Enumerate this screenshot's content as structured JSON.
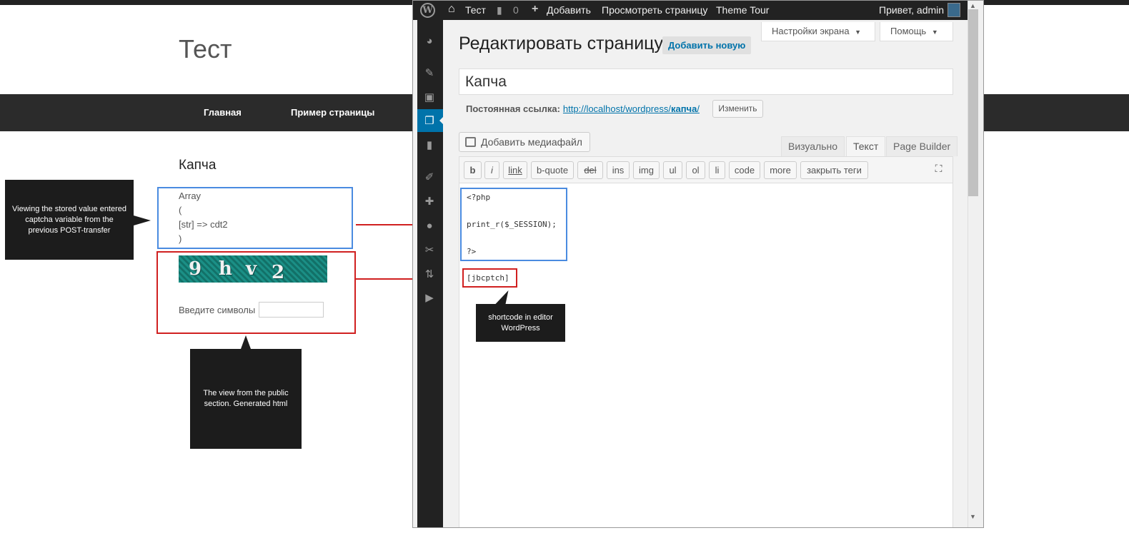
{
  "site": {
    "title": "Тест",
    "nav": [
      "Главная",
      "Пример страницы"
    ],
    "page_title": "Капча",
    "array_lines": [
      "Array",
      "(",
      "[str] => cdt2",
      ")"
    ],
    "captcha_chars": [
      "9",
      "h",
      "v",
      "2"
    ],
    "captcha_label": "Введите символы",
    "captcha_value": ""
  },
  "annotations": {
    "session_note": "Viewing the stored value entered captcha variable from the previous POST-transfer",
    "public_note": "The view from the public section. Generated html",
    "shortcode_note": "shortcode in editor WordPress"
  },
  "adminbar": {
    "site_name": "Тест",
    "comments_count": "0",
    "add_new": "Добавить",
    "view_page": "Просмотреть страницу",
    "theme_tour": "Theme Tour",
    "greeting": "Привет, admin"
  },
  "editor": {
    "screen_options": "Настройки экрана",
    "help": "Помощь",
    "heading": "Редактировать страницу",
    "add_new": "Добавить новую",
    "post_title": "Капча",
    "permalink_label": "Постоянная ссылка:",
    "permalink_base": "http://localhost/wordpress/",
    "permalink_slug": "капча",
    "permalink_end": "/",
    "change_button": "Изменить",
    "add_media": "Добавить медиафайл",
    "tabs": [
      "Визуально",
      "Текст",
      "Page Builder"
    ],
    "quicktags": [
      "b",
      "i",
      "link",
      "b-quote",
      "del",
      "ins",
      "img",
      "ul",
      "ol",
      "li",
      "code",
      "more",
      "закрыть теги"
    ],
    "code_lines": [
      "<?php",
      "",
      "print_r($_SESSION);",
      "",
      "?>"
    ],
    "shortcode": "[jbcptch]"
  },
  "icons": {
    "home": "home-icon",
    "comment": "comment-icon",
    "plus": "plus-icon",
    "media": "media-icon",
    "fullscreen": "fullscreen-icon"
  },
  "colors": {
    "accent": "#0073aa",
    "annotation_red": "#d02020",
    "annotation_blue": "#4a8be0",
    "callout_bg": "#1c1c1c"
  }
}
